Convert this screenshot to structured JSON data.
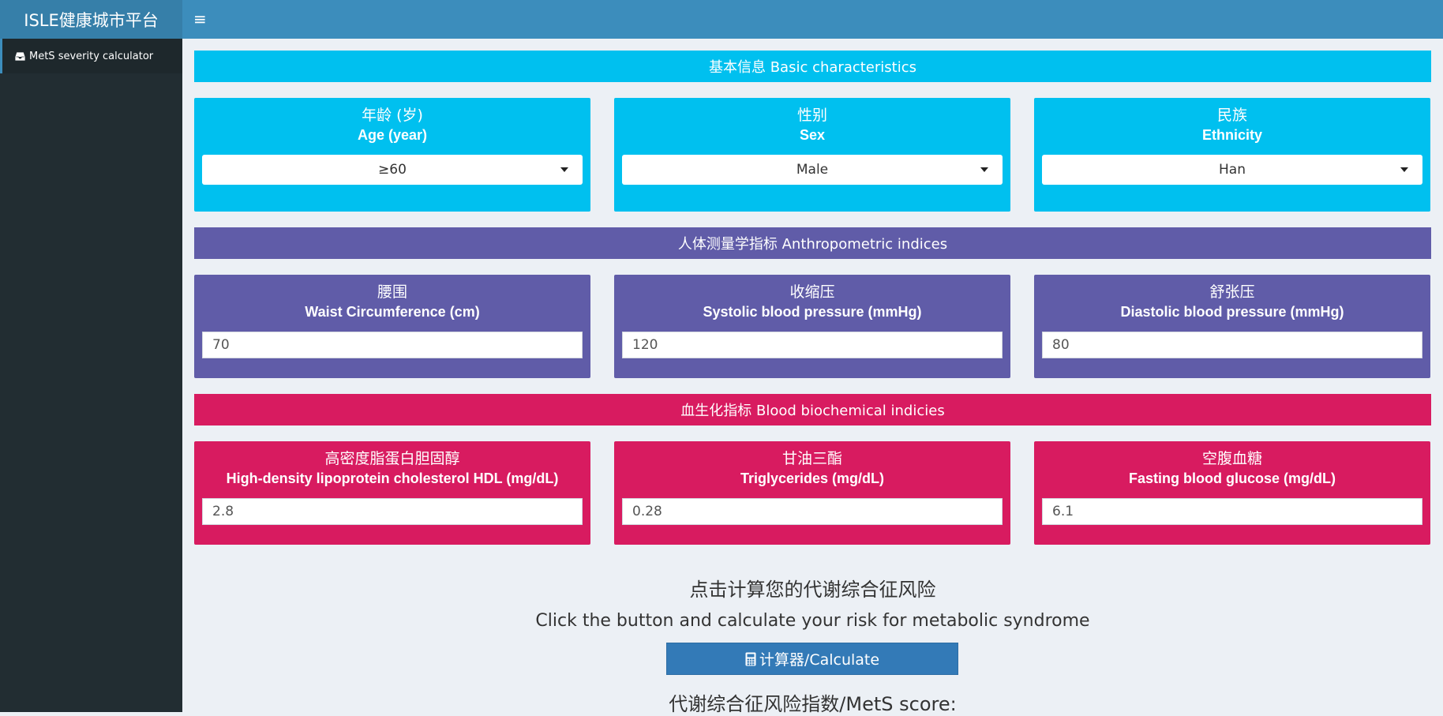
{
  "app": {
    "title": "ISLE健康城市平台"
  },
  "sidebar": {
    "items": [
      {
        "label": "MetS severity calculator",
        "icon": "inbox-icon"
      }
    ]
  },
  "sections": {
    "basic": {
      "header": "基本信息 Basic characteristics",
      "color": "#00c0ef",
      "fields": [
        {
          "label_cn": "年龄 (岁)",
          "label_en": "Age (year)",
          "value": "≥60"
        },
        {
          "label_cn": "性别",
          "label_en": "Sex",
          "value": "Male"
        },
        {
          "label_cn": "民族",
          "label_en": "Ethnicity",
          "value": "Han"
        }
      ]
    },
    "anthro": {
      "header": "人体测量学指标 Anthropometric indices",
      "color": "#605ca8",
      "fields": [
        {
          "label_cn": "腰围",
          "label_en": "Waist Circumference (cm)",
          "value": "70"
        },
        {
          "label_cn": "收缩压",
          "label_en": "Systolic blood pressure (mmHg)",
          "value": "120"
        },
        {
          "label_cn": "舒张压",
          "label_en": "Diastolic blood pressure (mmHg)",
          "value": "80"
        }
      ]
    },
    "blood": {
      "header": "血生化指标 Blood biochemical indicies",
      "color": "#d81b60",
      "fields": [
        {
          "label_cn": "高密度脂蛋白胆固醇",
          "label_en": "High-density lipoprotein cholesterol HDL (mg/dL)",
          "value": "2.8"
        },
        {
          "label_cn": "甘油三酯",
          "label_en": "Triglycerides (mg/dL)",
          "value": "0.28"
        },
        {
          "label_cn": "空腹血糖",
          "label_en": "Fasting blood glucose (mg/dL)",
          "value": "6.1"
        }
      ]
    }
  },
  "calc": {
    "prompt_cn": "点击计算您的代谢综合征风险",
    "prompt_en": "Click the button and calculate your risk for metabolic syndrome",
    "button_label": "计算器/Calculate",
    "score_label": "代谢综合征风险指数/MetS score:"
  }
}
